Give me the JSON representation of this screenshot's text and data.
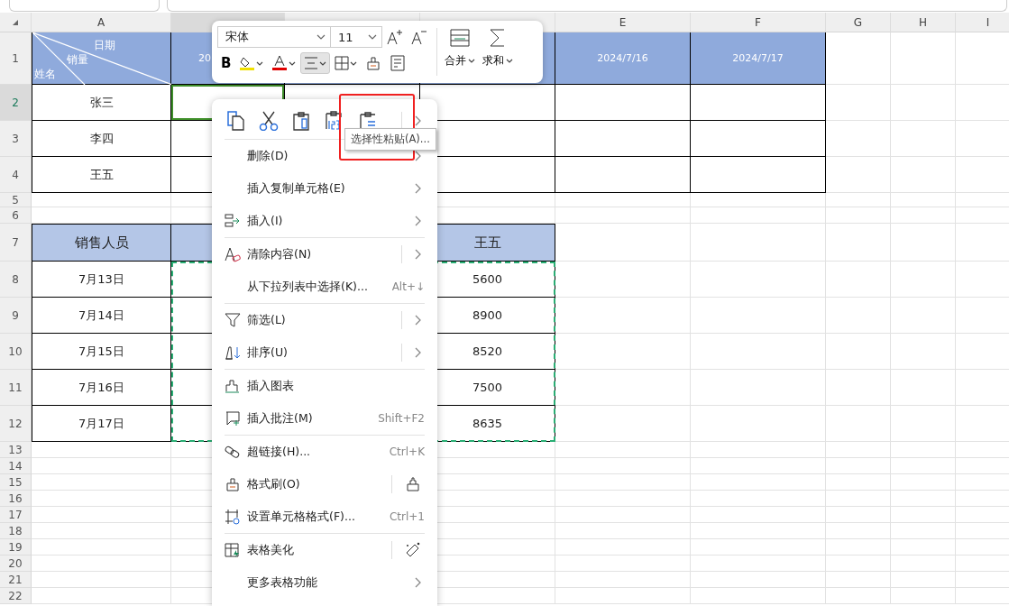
{
  "sheet": {
    "columns": [
      {
        "label": "A",
        "selected": false
      },
      {
        "selected": true
      },
      {
        "selected": false
      },
      {
        "selected": false
      },
      {
        "label": "E",
        "selected": false
      },
      {
        "label": "F",
        "selected": false
      },
      {
        "label": "G",
        "selected": false
      },
      {
        "label": "H",
        "selected": false
      },
      {
        "label": "I",
        "selected": false
      }
    ],
    "rows": [
      {
        "number": "1",
        "selected": false
      },
      {
        "number": "2",
        "selected": true
      },
      {
        "number": "3",
        "selected": false
      },
      {
        "number": "4",
        "selected": false
      },
      {
        "number": "5",
        "selected": false
      },
      {
        "number": "6",
        "selected": false
      },
      {
        "number": "7",
        "selected": false
      },
      {
        "number": "8",
        "selected": false
      },
      {
        "number": "9",
        "selected": false
      },
      {
        "number": "10",
        "selected": false
      },
      {
        "number": "11",
        "selected": false
      },
      {
        "number": "12",
        "selected": false
      },
      {
        "number": "13",
        "selected": false
      },
      {
        "number": "14",
        "selected": false
      },
      {
        "number": "15",
        "selected": false
      },
      {
        "number": "16",
        "selected": false
      },
      {
        "number": "17",
        "selected": false
      },
      {
        "number": "18",
        "selected": false
      },
      {
        "number": "19",
        "selected": false
      },
      {
        "number": "20",
        "selected": false
      },
      {
        "number": "21",
        "selected": false
      },
      {
        "number": "22",
        "selected": false
      }
    ]
  },
  "table_1": {
    "corner": {
      "top": "日期",
      "middle": "销量",
      "bottom": "姓名"
    },
    "header_cells": [
      "20",
      "2024/7/16",
      "2024/7/17"
    ],
    "names": [
      "张三",
      "李四",
      "王五"
    ]
  },
  "table_2": {
    "header_first": "销售人员",
    "header_last": "王五",
    "dates": [
      "7月13日",
      "7月14日",
      "7月15日",
      "7月16日",
      "7月17日"
    ],
    "values": [
      "5600",
      "8900",
      "8520",
      "7500",
      "8635"
    ]
  },
  "toolbar": {
    "font": "宋体",
    "size": "11",
    "buttons": [
      {
        "kind": "bold",
        "label": "B",
        "pressed": false
      },
      {
        "kind": "fill",
        "pressed": false
      },
      {
        "kind": "font_color",
        "pressed": false
      },
      {
        "kind": "align",
        "pressed": true
      },
      {
        "kind": "border",
        "pressed": false
      },
      {
        "kind": "painter",
        "pressed": false
      },
      {
        "kind": "wrap",
        "pressed": false
      }
    ],
    "large_buttons": [
      {
        "kind": "merge",
        "label": "合并"
      },
      {
        "kind": "sum",
        "label": "求和"
      }
    ]
  },
  "context_menu": {
    "tooltip": "选择性粘贴(A)...",
    "groups": [
      [
        {
          "label": "删除(D)",
          "kind": "submenu",
          "split": false
        },
        {
          "label": "插入复制单元格(E)",
          "kind": "submenu",
          "split": false
        },
        {
          "label": "插入(I)",
          "kind": "submenu",
          "split": false
        }
      ],
      [
        {
          "label": "清除内容(N)",
          "kind": "submenu",
          "split": true
        },
        {
          "label": "从下拉列表中选择(K)...",
          "kind": "shortcut",
          "shortcut": "Alt+↓",
          "split": false
        }
      ],
      [
        {
          "label": "筛选(L)",
          "kind": "submenu",
          "split": true
        },
        {
          "label": "排序(U)",
          "kind": "submenu",
          "split": true
        }
      ],
      [
        {
          "label": "插入图表",
          "kind": "plain",
          "split": false
        },
        {
          "label": "插入批注(M)",
          "kind": "shortcut",
          "shortcut": "Shift+F2",
          "split": false
        }
      ],
      [
        {
          "label": "超链接(H)...",
          "kind": "shortcut",
          "shortcut": "Ctrl+K",
          "split": false
        },
        {
          "label": "格式刷(O)",
          "kind": "tool",
          "split": true
        },
        {
          "label": "设置单元格格式(F)...",
          "kind": "shortcut",
          "shortcut": "Ctrl+1",
          "split": false
        }
      ],
      [
        {
          "label": "表格美化",
          "kind": "tool",
          "split": true
        },
        {
          "label": "更多表格功能",
          "kind": "submenu",
          "split": false
        }
      ]
    ]
  }
}
